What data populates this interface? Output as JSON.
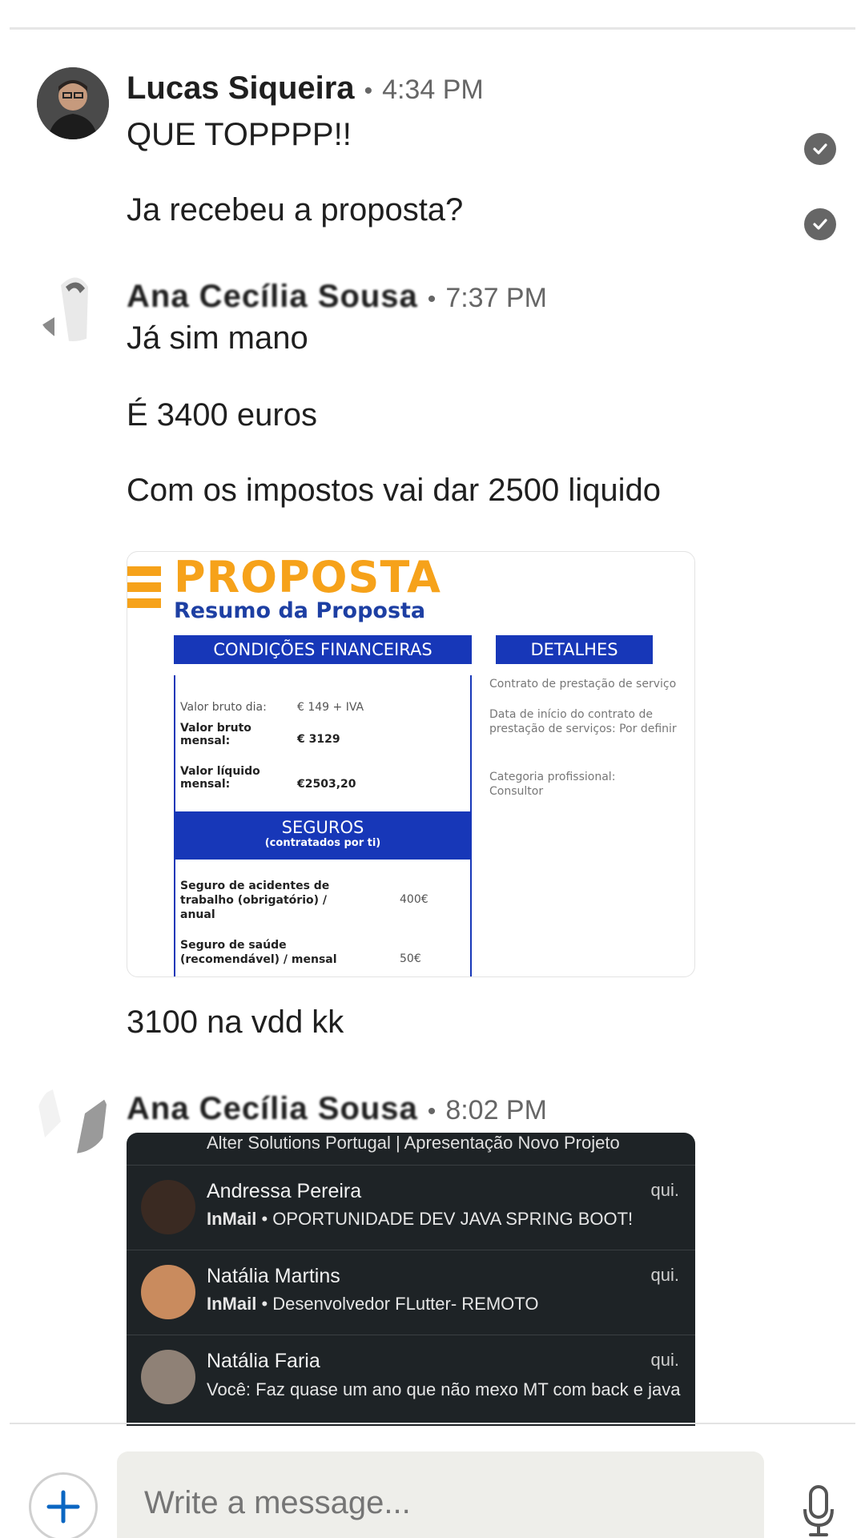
{
  "messages": [
    {
      "sender": "Lucas Siqueira",
      "time": "4:34 PM",
      "lines": [
        "QUE TOPPPP!!",
        "Ja recebeu a proposta?"
      ]
    },
    {
      "sender": "Ana Cecília Sousa",
      "time": "7:37 PM",
      "lines": [
        "Já sim mano",
        "É 3400 euros",
        "Com os impostos vai dar 2500 liquido",
        "3100 na vdd kk"
      ]
    },
    {
      "sender": "Ana Cecília Sousa",
      "time": "8:02 PM"
    }
  ],
  "separator_dot": "•",
  "proposal": {
    "title": "PROPOSTA",
    "subtitle": "Resumo da Proposta",
    "financial_header": "CONDIÇÕES FINANCEIRAS",
    "details_header": "DETALHES",
    "rows": [
      {
        "label": "Valor bruto dia:",
        "value": "€ 149 + IVA"
      },
      {
        "label": "Valor bruto mensal:",
        "value": "€ 3129"
      },
      {
        "label": "Valor líquido mensal:",
        "value": "€2503,20"
      }
    ],
    "insurance_header": "SEGUROS",
    "insurance_sub": "(contratados por ti)",
    "insurance": [
      {
        "label": "Seguro de acidentes de trabalho (obrigatório) / anual",
        "value": "400€"
      },
      {
        "label": "Seguro de saúde (recomendável) / mensal",
        "value": "50€"
      }
    ],
    "details": [
      "Contrato de prestação de serviço",
      "Data de início do contrato de prestação de serviços: Por definir",
      "Categoria profissional: Consultor"
    ]
  },
  "inbox": {
    "top": "Alter Solutions Portugal | Apresentação Novo Projeto",
    "rows": [
      {
        "name": "Andressa Pereira",
        "date": "qui.",
        "tag": "InMail",
        "sep": "•",
        "text": "OPORTUNIDADE DEV JAVA SPRING BOOT!"
      },
      {
        "name": "Natália Martins",
        "date": "qui.",
        "tag": "InMail",
        "sep": "•",
        "text": "Desenvolvedor FLutter- REMOTO"
      },
      {
        "name": "Natália Faria",
        "date": "qui.",
        "tag": "",
        "sep": "",
        "text": "Você: Faz quase um ano que não mexo MT com back e java"
      }
    ]
  },
  "composer": {
    "placeholder": "Write a message..."
  },
  "icons": {
    "read": "check-circle-icon",
    "add": "plus-icon",
    "mic": "microphone-icon"
  },
  "colors": {
    "accent": "#0a66c2",
    "proposal_orange": "#f6a21a",
    "proposal_blue": "#1737b8"
  }
}
